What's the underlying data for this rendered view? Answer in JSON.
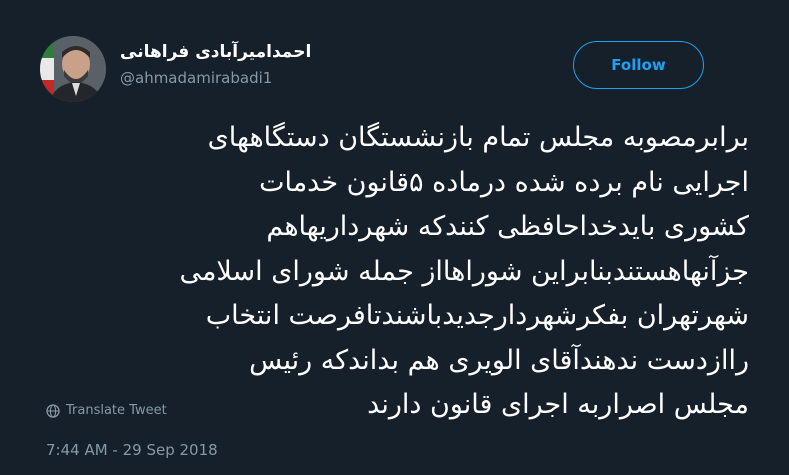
{
  "tweet": {
    "author_name": "احمدامیرآبادی فراهانی",
    "author_handle": "@ahmadamirabadi1",
    "follow_label": "Follow",
    "text_lines": [
      "برابرمصوبه مجلس تمام بازنشستگان دستگاههای",
      "اجرایی نام برده شده درماده ۵قانون خدمات",
      "کشوری بایدخداحافظی کنندکه شهرداریهاهم",
      "جزآنهاهستندبنابراین شوراهااز جمله شورای اسلامی",
      "شهرتهران بفکرشهردارجدیدباشندتافرصت انتخاب",
      "راازدست ندهندآقای الویری هم بداندکه رئیس",
      "مجلس اصراربه اجرای قانون دارند"
    ],
    "translate_label": "Translate Tweet",
    "timestamp": "7:44 AM - 29 Sep 2018"
  },
  "icons": {
    "avatar": "avatar-photo",
    "translate": "globe-icon"
  },
  "colors": {
    "background": "#15202b",
    "accent": "#1da1f2",
    "muted": "#8899a6",
    "text": "#ffffff"
  }
}
